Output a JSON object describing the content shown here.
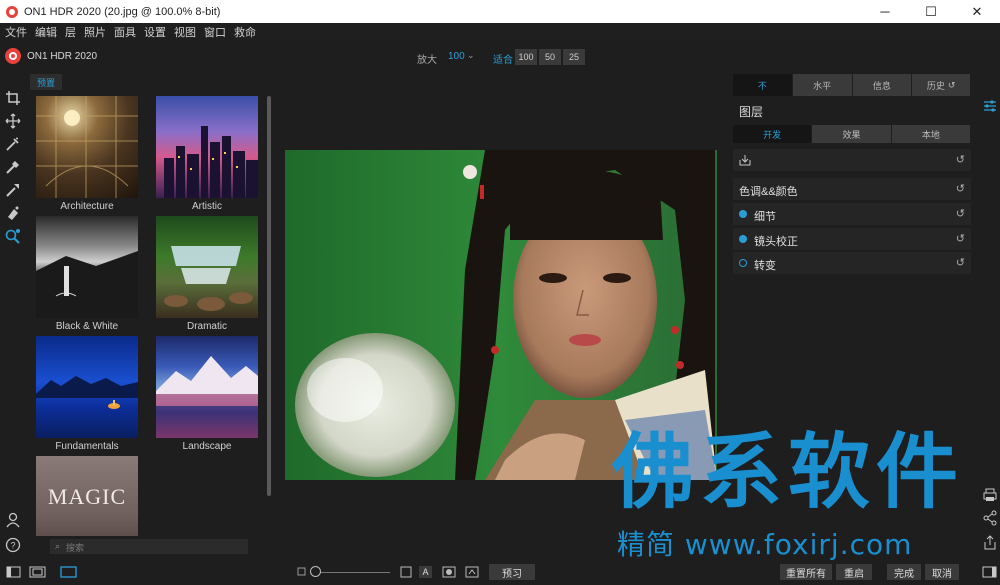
{
  "window": {
    "title": "ON1 HDR 2020 (20.jpg @ 100.0% 8-bit)",
    "minimize": "─",
    "maximize": "☐",
    "close": "✕"
  },
  "menu": [
    "文件",
    "编辑",
    "层",
    "照片",
    "面具",
    "设置",
    "视图",
    "窗口",
    "救命"
  ],
  "toolbar": {
    "app_name": "ON1 HDR 2020",
    "zoom_label": "放大",
    "zoom_value": "100",
    "zoom_caret": "⌄",
    "fit_label": "适合",
    "zoom_presets": [
      "100",
      "50",
      "25"
    ]
  },
  "left_panel": {
    "tab": "预置",
    "presets": [
      "Architecture",
      "Artistic",
      "Black & White",
      "Dramatic",
      "Fundamentals",
      "Landscape",
      ""
    ],
    "magic_thumb_text": "MAGIC",
    "search_placeholder": "搜索"
  },
  "right_panel": {
    "tabs": [
      "不",
      "水平",
      "信息",
      "历史"
    ],
    "layers_title": "图层",
    "subtabs": [
      "开发",
      "效果",
      "本地"
    ],
    "rows": [
      {
        "label": "",
        "dot": "none"
      },
      {
        "label": "色调&&颜色",
        "dot": "none"
      },
      {
        "label": "细节",
        "dot": "filled"
      },
      {
        "label": "镜头校正",
        "dot": "filled"
      },
      {
        "label": "转变",
        "dot": "outline"
      }
    ],
    "reset_icon": "↺"
  },
  "bottom": {
    "preview": "预习",
    "reset_all": "重置所有",
    "reset": "重启",
    "done": "完成",
    "cancel": "取消",
    "a_label": "A"
  },
  "watermark": {
    "big": "佛系软件",
    "small": "精简 www.foxirj.com"
  },
  "colors": {
    "accent": "#2a9fd6",
    "logo": "#e8413c",
    "watermark": "#1a8fd0"
  }
}
